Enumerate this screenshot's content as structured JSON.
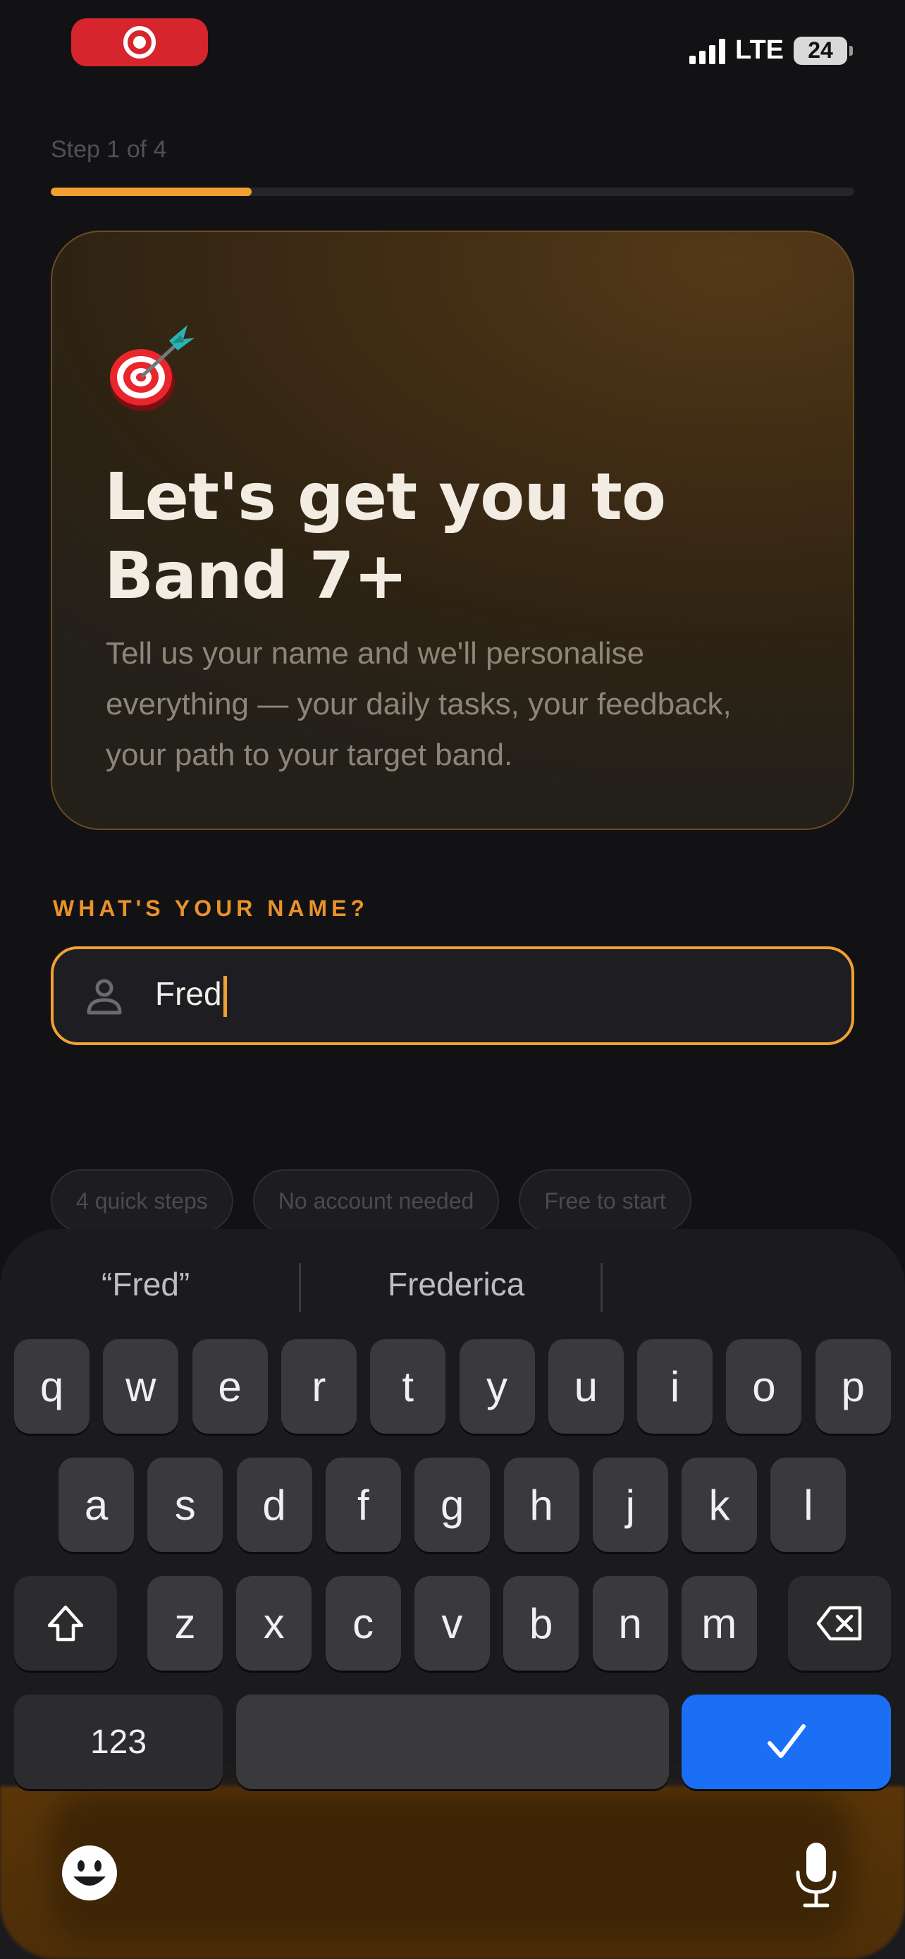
{
  "status_bar": {
    "network": "LTE",
    "battery": "24"
  },
  "progress": {
    "step_label": "Step 1 of 4",
    "fraction": 0.25
  },
  "hero": {
    "emoji": "dart-target-icon",
    "title_line1": "Let's get you to",
    "title_line2": "Band 7+",
    "subtitle": "Tell us your name and we'll personalise everything — your daily tasks, your feedback, your path to your target band."
  },
  "name_section": {
    "label": "WHAT'S YOUR NAME?",
    "value": "Fred"
  },
  "chips": [
    "4 quick steps",
    "No account needed",
    "Free to start"
  ],
  "keyboard": {
    "suggestions": [
      "“Fred”",
      "Frederica"
    ],
    "row1": [
      "q",
      "w",
      "e",
      "r",
      "t",
      "y",
      "u",
      "i",
      "o",
      "p"
    ],
    "row2": [
      "a",
      "s",
      "d",
      "f",
      "g",
      "h",
      "j",
      "k",
      "l"
    ],
    "row3": [
      "z",
      "x",
      "c",
      "v",
      "b",
      "n",
      "m"
    ],
    "numbers_label": "123",
    "done_icon": "checkmark-icon",
    "accent": "#1a6ff4"
  },
  "colors": {
    "accent": "#f2a032",
    "background": "#121214"
  }
}
